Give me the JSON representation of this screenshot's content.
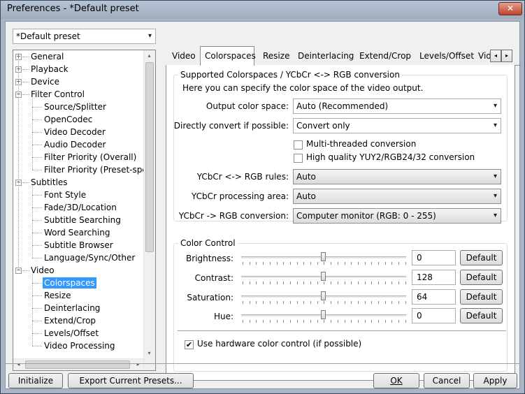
{
  "window": {
    "title": "Preferences - *Default preset",
    "close_glyph": "✕"
  },
  "preset": {
    "value": "*Default preset"
  },
  "tree": {
    "items": [
      {
        "label": "General",
        "level": 0,
        "expander": "+"
      },
      {
        "label": "Playback",
        "level": 0,
        "expander": "+"
      },
      {
        "label": "Device",
        "level": 0,
        "expander": "+"
      },
      {
        "label": "Filter Control",
        "level": 0,
        "expander": "−"
      },
      {
        "label": "Source/Splitter",
        "level": 1
      },
      {
        "label": "OpenCodec",
        "level": 1
      },
      {
        "label": "Video Decoder",
        "level": 1
      },
      {
        "label": "Audio Decoder",
        "level": 1
      },
      {
        "label": "Filter Priority (Overall)",
        "level": 1
      },
      {
        "label": "Filter Priority (Preset-specifi",
        "level": 1
      },
      {
        "label": "Subtitles",
        "level": 0,
        "expander": "−"
      },
      {
        "label": "Font Style",
        "level": 1
      },
      {
        "label": "Fade/3D/Location",
        "level": 1
      },
      {
        "label": "Subtitle Searching",
        "level": 1
      },
      {
        "label": "Word Searching",
        "level": 1
      },
      {
        "label": "Subtitle Browser",
        "level": 1
      },
      {
        "label": "Language/Sync/Other",
        "level": 1
      },
      {
        "label": "Video",
        "level": 0,
        "expander": "−"
      },
      {
        "label": "Colorspaces",
        "level": 1,
        "selected": true
      },
      {
        "label": "Resize",
        "level": 1
      },
      {
        "label": "Deinterlacing",
        "level": 1
      },
      {
        "label": "Extend/Crop",
        "level": 1
      },
      {
        "label": "Levels/Offset",
        "level": 1
      },
      {
        "label": "Video Processing",
        "level": 1
      }
    ]
  },
  "tabs": [
    {
      "label": "Video"
    },
    {
      "label": "Colorspaces",
      "active": true
    },
    {
      "label": "Resize"
    },
    {
      "label": "Deinterlacing"
    },
    {
      "label": "Extend/Crop"
    },
    {
      "label": "Levels/Offset"
    },
    {
      "label": "Vid"
    }
  ],
  "colorspace_group": {
    "title": "Supported Colorspaces / YCbCr <-> RGB conversion",
    "description": "Here you can specify the color space of the video output.",
    "output_color_space": {
      "label": "Output color space:",
      "value": "Auto (Recommended)"
    },
    "direct_convert": {
      "label": "Directly convert if possible:",
      "value": "Convert only"
    },
    "multithreaded": {
      "label": "Multi-threaded conversion",
      "checked": false
    },
    "high_quality": {
      "label": "High quality YUY2/RGB24/32 conversion",
      "checked": false
    },
    "rgb_rules": {
      "label": "YCbCr <-> RGB rules:",
      "value": "Auto"
    },
    "processing_area": {
      "label": "YCbCr processing area:",
      "value": "Auto"
    },
    "rgb_conversion": {
      "label": "YCbCr -> RGB conversion:",
      "value": "Computer monitor (RGB: 0 - 255)"
    }
  },
  "color_control": {
    "title": "Color Control",
    "default_label": "Default",
    "rows": [
      {
        "label": "Brightness:",
        "value": "0"
      },
      {
        "label": "Contrast:",
        "value": "128"
      },
      {
        "label": "Saturation:",
        "value": "64"
      },
      {
        "label": "Hue:",
        "value": "0"
      }
    ],
    "hardware": {
      "label": "Use hardware color control (if possible)",
      "checked": true
    }
  },
  "footer": {
    "initialize": "Initialize",
    "export": "Export Current Presets...",
    "ok": "OK",
    "cancel": "Cancel",
    "apply": "Apply"
  },
  "icons": {
    "dropdown": "▾",
    "check": "✔",
    "arrow_left": "◂",
    "arrow_right": "▸",
    "arrow_up": "▴",
    "arrow_down": "▾"
  }
}
